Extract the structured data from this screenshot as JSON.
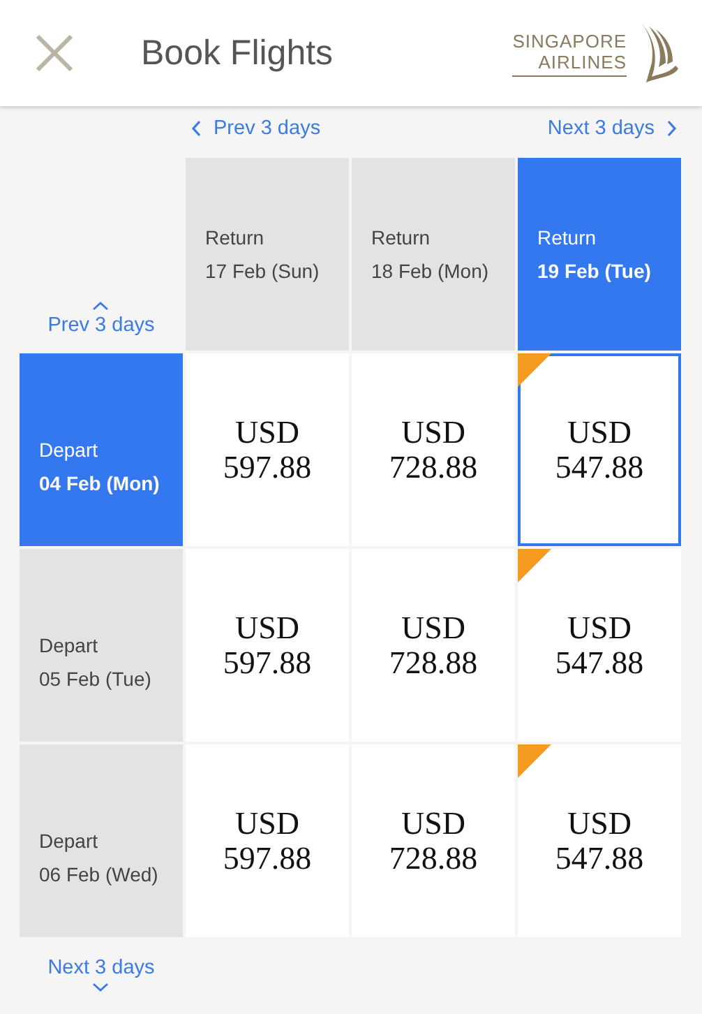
{
  "header": {
    "title": "Book Flights",
    "logo_lines": [
      "SINGAPORE",
      "AIRLINES"
    ]
  },
  "return_nav": {
    "prev": "Prev 3 days",
    "next": "Next 3 days"
  },
  "depart_nav": {
    "prev": "Prev 3 days",
    "next": "Next 3 days"
  },
  "return_dates": [
    {
      "label": "Return",
      "date": "17 Feb (Sun)",
      "selected": false
    },
    {
      "label": "Return",
      "date": "18 Feb (Mon)",
      "selected": false
    },
    {
      "label": "Return",
      "date": "19 Feb (Tue)",
      "selected": true
    }
  ],
  "rows": [
    {
      "label": "Depart",
      "date": "04 Feb (Mon)",
      "selected": true,
      "fares": [
        {
          "currency": "USD",
          "amount": "597.88",
          "selected": false,
          "flagged": false
        },
        {
          "currency": "USD",
          "amount": "728.88",
          "selected": false,
          "flagged": false
        },
        {
          "currency": "USD",
          "amount": "547.88",
          "selected": true,
          "flagged": true
        }
      ]
    },
    {
      "label": "Depart",
      "date": "05 Feb (Tue)",
      "selected": false,
      "fares": [
        {
          "currency": "USD",
          "amount": "597.88",
          "selected": false,
          "flagged": false
        },
        {
          "currency": "USD",
          "amount": "728.88",
          "selected": false,
          "flagged": false
        },
        {
          "currency": "USD",
          "amount": "547.88",
          "selected": false,
          "flagged": true
        }
      ]
    },
    {
      "label": "Depart",
      "date": "06 Feb (Wed)",
      "selected": false,
      "fares": [
        {
          "currency": "USD",
          "amount": "597.88",
          "selected": false,
          "flagged": false
        },
        {
          "currency": "USD",
          "amount": "728.88",
          "selected": false,
          "flagged": false
        },
        {
          "currency": "USD",
          "amount": "547.88",
          "selected": false,
          "flagged": true
        }
      ]
    }
  ]
}
